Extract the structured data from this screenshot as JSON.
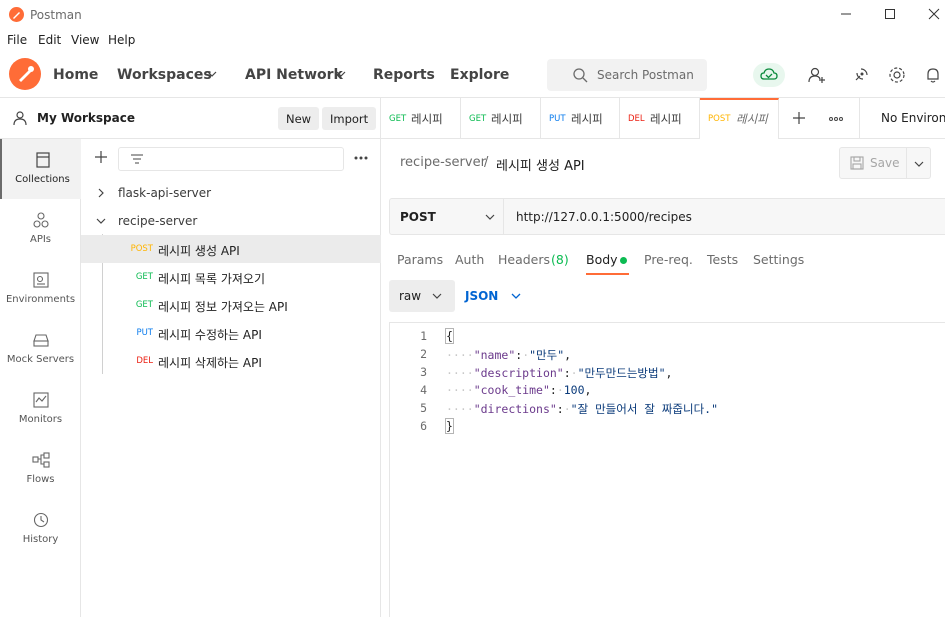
{
  "app": {
    "title": "Postman"
  },
  "menu": [
    "File",
    "Edit",
    "View",
    "Help"
  ],
  "nav": {
    "home": "Home",
    "workspaces": "Workspaces",
    "api_network": "API Network",
    "reports": "Reports",
    "explore": "Explore",
    "search_placeholder": "Search Postman"
  },
  "workspace": {
    "name": "My Workspace",
    "new_label": "New",
    "import_label": "Import"
  },
  "rail": [
    {
      "label": "Collections",
      "icon": "collections-icon"
    },
    {
      "label": "APIs",
      "icon": "apis-icon"
    },
    {
      "label": "Environments",
      "icon": "environments-icon"
    },
    {
      "label": "Mock Servers",
      "icon": "mock-servers-icon"
    },
    {
      "label": "Monitors",
      "icon": "monitors-icon"
    },
    {
      "label": "Flows",
      "icon": "flows-icon"
    },
    {
      "label": "History",
      "icon": "history-icon"
    }
  ],
  "tree": {
    "collections": [
      {
        "name": "flask-api-server",
        "expanded": false
      },
      {
        "name": "recipe-server",
        "expanded": true
      }
    ],
    "requests": [
      {
        "method": "POST",
        "name": "레시피 생성 API",
        "active": true
      },
      {
        "method": "GET",
        "name": "레시피 목록 가져오기"
      },
      {
        "method": "GET",
        "name": "레시피 정보 가져오는 API"
      },
      {
        "method": "PUT",
        "name": "레시피 수정하는 API"
      },
      {
        "method": "DEL",
        "name": "레시피 삭제하는 API"
      }
    ]
  },
  "tabs": [
    {
      "method": "GET",
      "label": "레시피"
    },
    {
      "method": "GET",
      "label": "레시피"
    },
    {
      "method": "PUT",
      "label": "레시피"
    },
    {
      "method": "DEL",
      "label": "레시피"
    },
    {
      "method": "POST",
      "label": "레시피",
      "active": true
    }
  ],
  "environment": {
    "label": "No Environm"
  },
  "request": {
    "breadcrumb_server": "recipe-server",
    "breadcrumb_sep": "/",
    "breadcrumb_name": "레시피 생성 API",
    "save_label": "Save",
    "method": "POST",
    "url": "http://127.0.0.1:5000/recipes"
  },
  "request_tabs": {
    "params": "Params",
    "auth": "Auth",
    "headers": "Headers",
    "headers_count": "(8)",
    "body": "Body",
    "prereq": "Pre-req.",
    "tests": "Tests",
    "settings": "Settings"
  },
  "body": {
    "mode": "raw",
    "language": "JSON",
    "line_numbers": [
      "1",
      "2",
      "3",
      "4",
      "5",
      "6"
    ],
    "open_brace": "{",
    "close_brace": "}",
    "fields": [
      {
        "key": "\"name\"",
        "value": "\"만두\"",
        "comma": ","
      },
      {
        "key": "\"description\"",
        "value": "\"만두만드는방법\"",
        "comma": ","
      },
      {
        "key": "\"cook_time\"",
        "value": "100",
        "comma": ","
      },
      {
        "key": "\"directions\"",
        "value": "\"잘 만들어서 잘 짜줍니다.\"",
        "comma": ""
      }
    ]
  },
  "colors": {
    "accent": "#ff6c37",
    "get": "#0cbb52",
    "post": "#ffb400",
    "put": "#097bed",
    "del": "#eb2013",
    "link": "#0265d2"
  }
}
